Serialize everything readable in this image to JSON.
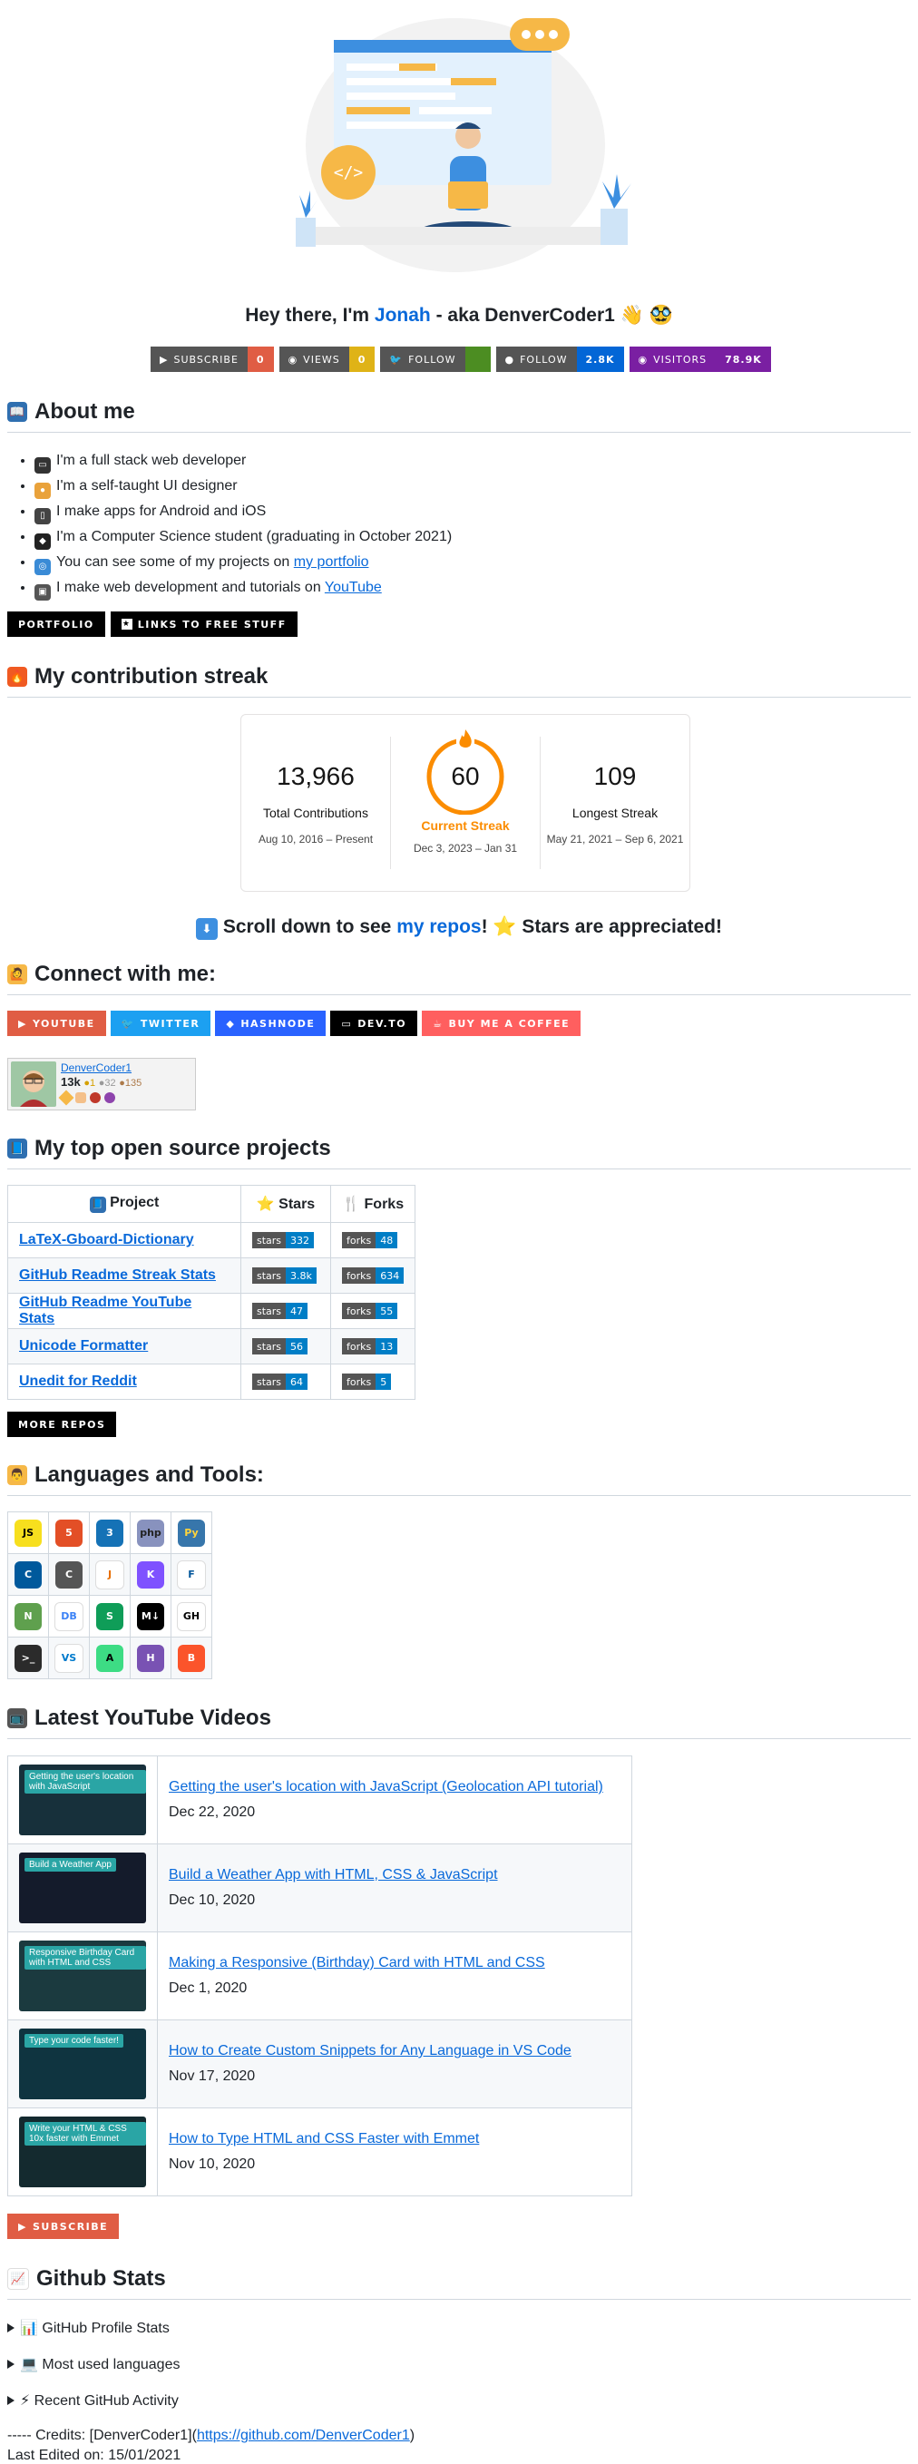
{
  "header": {
    "greeting_prefix": "Hey there, I'm ",
    "name": "Jonah",
    "greeting_suffix": " - aka DenverCoder1 👋 🥸"
  },
  "badges": [
    {
      "label": "SUBSCRIBE",
      "value": "0",
      "color": "#e05d44",
      "icon": "youtube-icon"
    },
    {
      "label": "VIEWS",
      "value": "0",
      "color": "#dfb317",
      "icon": "eye-icon"
    },
    {
      "label": "FOLLOW",
      "value": "",
      "color": "#4c8d22",
      "icon": "twitter-icon"
    },
    {
      "label": "FOLLOW",
      "value": "2.8K",
      "color": "#0366d6",
      "icon": "github-icon"
    },
    {
      "label": "VISITORS",
      "value": "78.9K",
      "color": "#7a1fa2",
      "icon": "eye-icon"
    }
  ],
  "about": {
    "title": "About me",
    "items": [
      {
        "emoji_color": "#333",
        "text": "I'm a full stack web developer"
      },
      {
        "emoji_color": "#e9a23b",
        "text": "I'm a self-taught UI designer"
      },
      {
        "emoji_color": "#444",
        "text": "I make apps for Android and iOS"
      },
      {
        "emoji_color": "#222",
        "text": "I'm a Computer Science student (graduating in October 2021)"
      },
      {
        "emoji_color": "#3a8bd6",
        "text_before": "You can see some of my projects on ",
        "link": "my portfolio"
      },
      {
        "emoji_color": "#555",
        "text_before": "I make web development and tutorials on ",
        "link": "YouTube"
      }
    ],
    "buttons": [
      "PORTFOLIO",
      "LINKS TO FREE STUFF"
    ]
  },
  "streak": {
    "title": "My contribution streak",
    "total": "13,966",
    "total_label": "Total Contributions",
    "total_range": "Aug 10, 2016 – Present",
    "current": "60",
    "current_label": "Current Streak",
    "current_range": "Dec 3, 2023 – Jan 31",
    "longest": "109",
    "longest_label": "Longest Streak",
    "longest_range": "May 21, 2021 – Sep 6, 2021",
    "accent": "#fb8c00"
  },
  "scroll": {
    "before": "Scroll down to see ",
    "link": "my repos",
    "after": "! ⭐ Stars are appreciated!"
  },
  "connect": {
    "title": "Connect with me:",
    "buttons": [
      {
        "label": "YOUTUBE",
        "color": "#e05d44",
        "icon": "youtube-icon"
      },
      {
        "label": "TWITTER",
        "color": "#1ca0f1",
        "icon": "twitter-icon"
      },
      {
        "label": "HASHNODE",
        "color": "#2962ff",
        "icon": "hashnode-icon"
      },
      {
        "label": "DEV.TO",
        "color": "#000000",
        "icon": "devto-icon"
      },
      {
        "label": "BUY ME A COFFEE",
        "color": "#ff5f5f",
        "icon": "coffee-icon"
      }
    ],
    "flair": {
      "user": "DenverCoder1",
      "rep": "13k",
      "gold": "●1",
      "silver": "●32",
      "bronze": "●135"
    }
  },
  "projects": {
    "title": "My top open source projects",
    "headers": [
      "Project",
      "Stars",
      "Forks"
    ],
    "rows": [
      {
        "name": "LaTeX-Gboard-Dictionary",
        "stars": "332",
        "forks": "48"
      },
      {
        "name": "GitHub Readme Streak Stats",
        "stars": "3.8k",
        "forks": "634"
      },
      {
        "name": "GitHub Readme YouTube Stats",
        "stars": "47",
        "forks": "55"
      },
      {
        "name": "Unicode Formatter",
        "stars": "56",
        "forks": "13"
      },
      {
        "name": "Unedit for Reddit",
        "stars": "64",
        "forks": "5"
      }
    ],
    "stars_key": "stars",
    "forks_key": "forks",
    "more_button": "MORE REPOS"
  },
  "tools": {
    "title": "Languages and Tools:",
    "grid": [
      [
        {
          "t": "JS",
          "c": "#f7df1e",
          "f": "#000"
        },
        {
          "t": "5",
          "c": "#e34f26",
          "f": "#fff"
        },
        {
          "t": "3",
          "c": "#1572b6",
          "f": "#fff"
        },
        {
          "t": "php",
          "c": "#8892be",
          "f": "#222"
        },
        {
          "t": "Py",
          "c": "#3776ab",
          "f": "#ffd43b"
        }
      ],
      [
        {
          "t": "C",
          "c": "#00599c",
          "f": "#fff"
        },
        {
          "t": "C",
          "c": "#555555",
          "f": "#fff"
        },
        {
          "t": "J",
          "c": "#ffffff",
          "f": "#e76f00"
        },
        {
          "t": "K",
          "c": "#7f52ff",
          "f": "#fff"
        },
        {
          "t": "F",
          "c": "#ffffff",
          "f": "#02569b"
        }
      ],
      [
        {
          "t": "N",
          "c": "#5fa04e",
          "f": "#fff"
        },
        {
          "t": "DB",
          "c": "#ffffff",
          "f": "#3b82f6"
        },
        {
          "t": "S",
          "c": "#0f9d58",
          "f": "#fff"
        },
        {
          "t": "M↓",
          "c": "#000000",
          "f": "#fff"
        },
        {
          "t": "GH",
          "c": "#ffffff",
          "f": "#000"
        }
      ],
      [
        {
          "t": ">_",
          "c": "#2b2b2b",
          "f": "#fff"
        },
        {
          "t": "VS",
          "c": "#ffffff",
          "f": "#007acc"
        },
        {
          "t": "A",
          "c": "#3ddc84",
          "f": "#000"
        },
        {
          "t": "H",
          "c": "#7952b3",
          "f": "#fff"
        },
        {
          "t": "B",
          "c": "#fb542b",
          "f": "#fff"
        }
      ]
    ]
  },
  "videos": {
    "title": "Latest YouTube Videos",
    "items": [
      {
        "title": "Getting the user's location with JavaScript (Geolocation API tutorial)",
        "date": "Dec 22, 2020",
        "cap": "Getting the user's location with JavaScript",
        "bg": "#17303b"
      },
      {
        "title": "Build a Weather App with HTML, CSS & JavaScript",
        "date": "Dec 10, 2020",
        "cap": "Build a Weather App",
        "bg": "#141b2b"
      },
      {
        "title": "Making a Responsive (Birthday) Card with HTML and CSS",
        "date": "Dec 1, 2020",
        "cap": "Responsive Birthday Card with HTML and CSS",
        "bg": "#1b3a3f"
      },
      {
        "title": "How to Create Custom Snippets for Any Language in VS Code",
        "date": "Nov 17, 2020",
        "cap": "Type your code faster!",
        "bg": "#0f3440"
      },
      {
        "title": "How to Type HTML and CSS Faster with Emmet",
        "date": "Nov 10, 2020",
        "cap": "Write your HTML & CSS 10x faster with Emmet",
        "bg": "#142a2f"
      }
    ],
    "subscribe": "SUBSCRIBE"
  },
  "github_stats": {
    "title": "Github Stats",
    "details": [
      "📊 GitHub Profile Stats",
      "💻 Most used languages",
      "⚡ Recent GitHub Activity"
    ]
  },
  "footer": {
    "credits": "----- Credits: [DenverCoder1](",
    "credits_link": "https://github.com/DenverCoder1",
    "credits_end": ")",
    "edited": "Last Edited on: 15/01/2021"
  }
}
